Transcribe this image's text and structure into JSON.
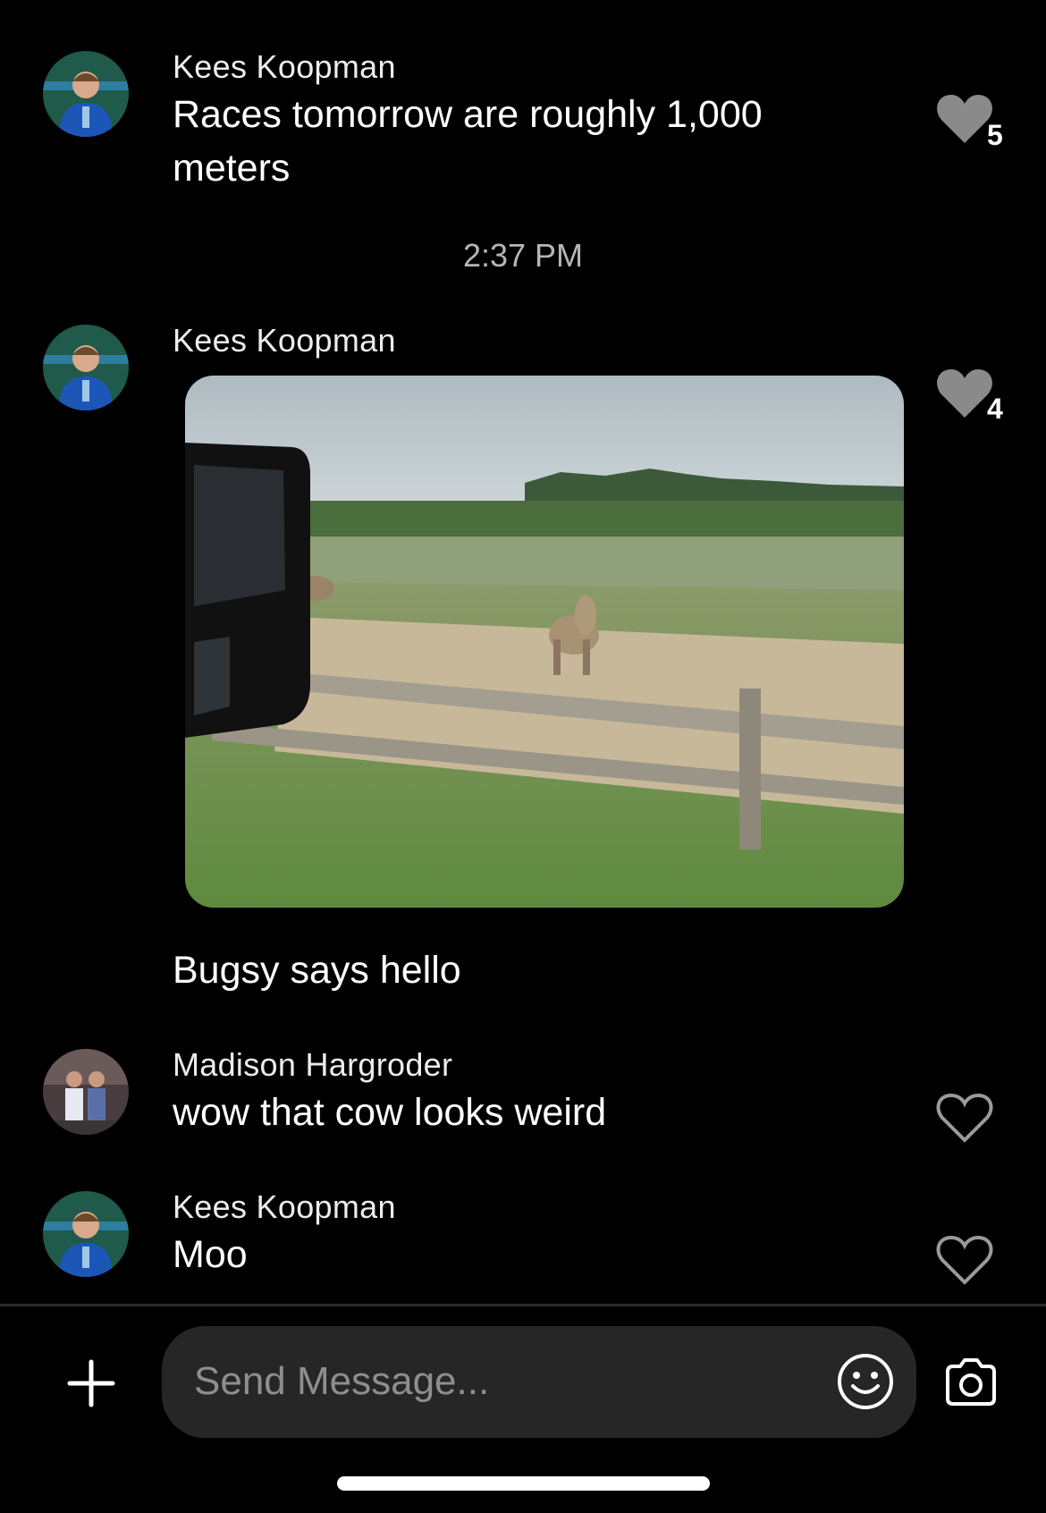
{
  "messages": [
    {
      "sender": "Kees Koopman",
      "text": "Races tomorrow are roughly 1,000 meters",
      "likes": "5",
      "liked": true,
      "avatar": "kees-avatar"
    },
    {
      "sender": "Kees Koopman",
      "attachment": "photo",
      "likes": "4",
      "liked": true,
      "avatar": "kees-avatar"
    },
    {
      "text": "Bugsy says hello"
    },
    {
      "sender": "Madison Hargroder",
      "text": "wow that cow looks weird",
      "liked": false,
      "avatar": "madison-avatar"
    },
    {
      "sender": "Kees Koopman",
      "text": "Moo",
      "liked": false,
      "avatar": "kees-avatar"
    }
  ],
  "timestamp": "2:37 PM",
  "composer": {
    "placeholder": "Send Message..."
  },
  "icons": {
    "add": "plus-icon",
    "emoji": "smiley-icon",
    "camera": "camera-icon",
    "like": "heart-icon"
  },
  "colors": {
    "background": "#000000",
    "input_bg": "#262626",
    "heart_filled": "#8a8a8a",
    "heart_outline": "#9a9a9a"
  }
}
